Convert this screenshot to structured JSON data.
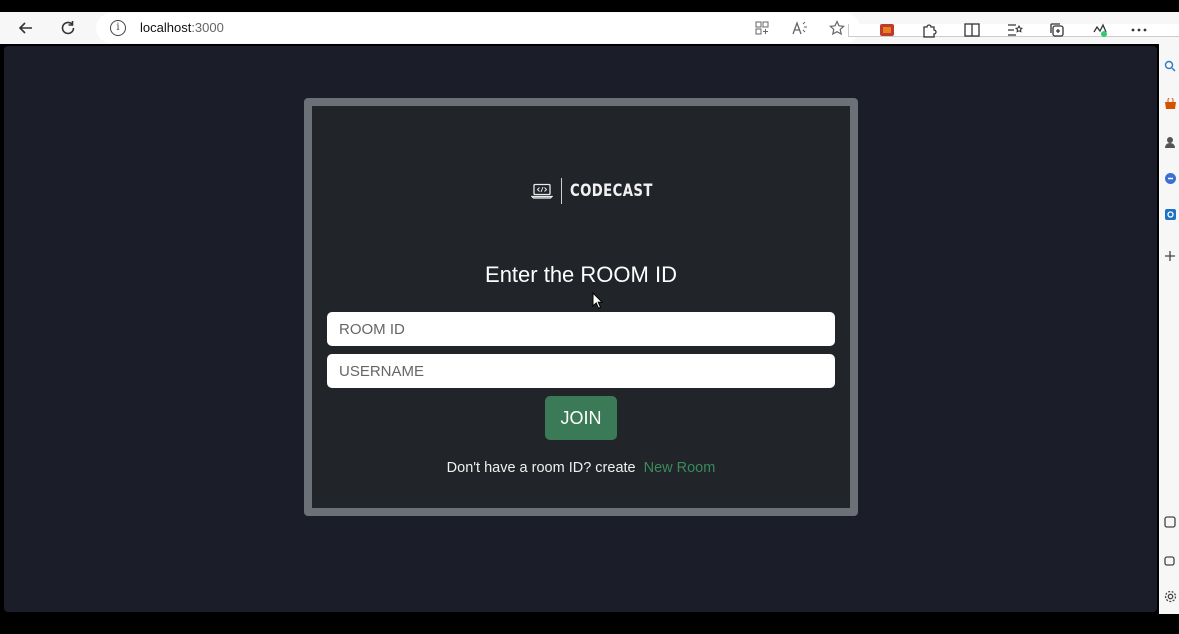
{
  "browser": {
    "back_icon": "back-arrow-icon",
    "refresh_icon": "refresh-icon",
    "address": {
      "host": "localhost",
      "port": ":3000"
    }
  },
  "app": {
    "logo_text": "CODECAST",
    "heading": "Enter the ROOM ID",
    "room_id_placeholder": "ROOM ID",
    "username_placeholder": "USERNAME",
    "join_label": "JOIN",
    "footer_text": "Don't have a room ID? create",
    "new_room_link": "New Room"
  },
  "colors": {
    "page_bg": "#1b1e29",
    "card_bg": "#212428",
    "card_border": "#6b7177",
    "accent": "#3a7a57",
    "link": "#3a8a5e"
  }
}
